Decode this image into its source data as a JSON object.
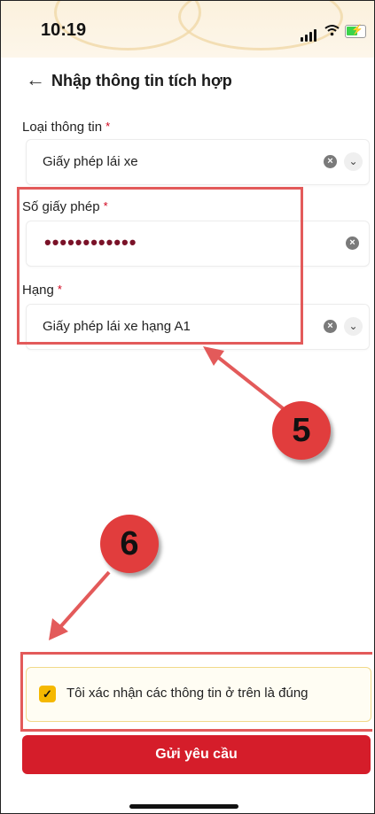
{
  "status_bar": {
    "time": "10:19",
    "icons": [
      "signal-icon",
      "wifi-icon",
      "battery-icon"
    ],
    "battery_color": "#3bd34a"
  },
  "header": {
    "back_icon": "←",
    "title": "Nhập thông tin tích hợp"
  },
  "form": {
    "info_type": {
      "label": "Loại thông tin",
      "required_mark": "*",
      "value": "Giấy phép lái xe",
      "clear_icon": "×",
      "dropdown_icon": "⌄"
    },
    "license_number": {
      "label": "Số giấy phép",
      "required_mark": "*",
      "value": "••••••••••••",
      "clear_icon": "×"
    },
    "license_class": {
      "label": "Hạng",
      "required_mark": "*",
      "value": "Giấy phép lái xe hạng A1",
      "clear_icon": "×",
      "dropdown_icon": "⌄"
    }
  },
  "annotations": {
    "badge_5": "5",
    "badge_6": "6",
    "highlight_color": "#e35a5a"
  },
  "confirm": {
    "checked": true,
    "check_mark": "✓",
    "text": "Tôi xác nhận các thông tin ở trên là đúng"
  },
  "submit": {
    "label": "Gửi yêu cầu",
    "color": "#d51d2a"
  },
  "accent_colors": {
    "checkbox": "#f5b800",
    "password_dots": "#7a1228"
  }
}
